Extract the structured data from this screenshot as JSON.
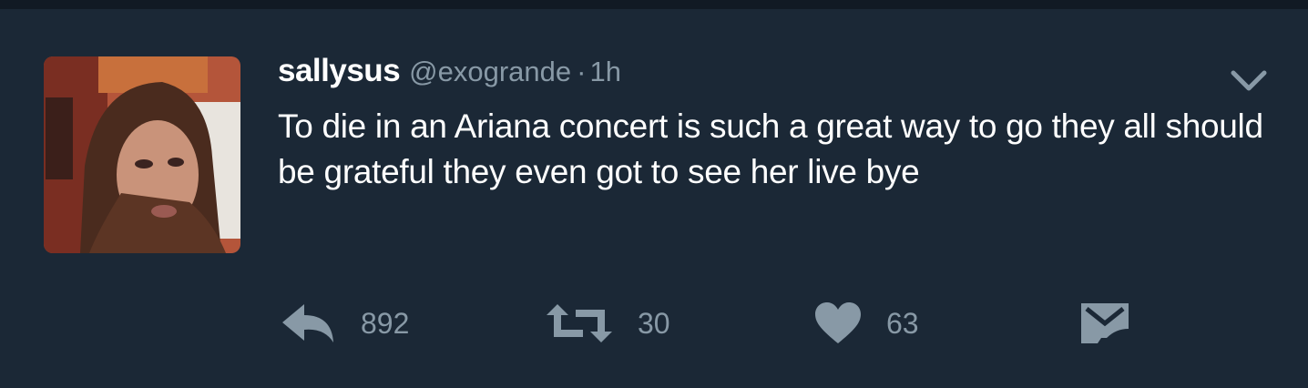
{
  "tweet": {
    "display_name": "sallysus",
    "handle": "@exogrande",
    "separator": "·",
    "time": "1h",
    "text": "To die in an Ariana concert is such a great way to go they all should be grateful they even got to see her live bye",
    "replies": "892",
    "retweets": "30",
    "likes": "63"
  },
  "icons": {
    "avatar": "profile-photo",
    "menu": "chevron-down-icon",
    "reply": "reply-icon",
    "retweet": "retweet-icon",
    "like": "heart-icon",
    "dm": "direct-message-icon"
  },
  "colors": {
    "background": "#1b2836",
    "text": "#ffffff",
    "muted": "#8899a6"
  }
}
